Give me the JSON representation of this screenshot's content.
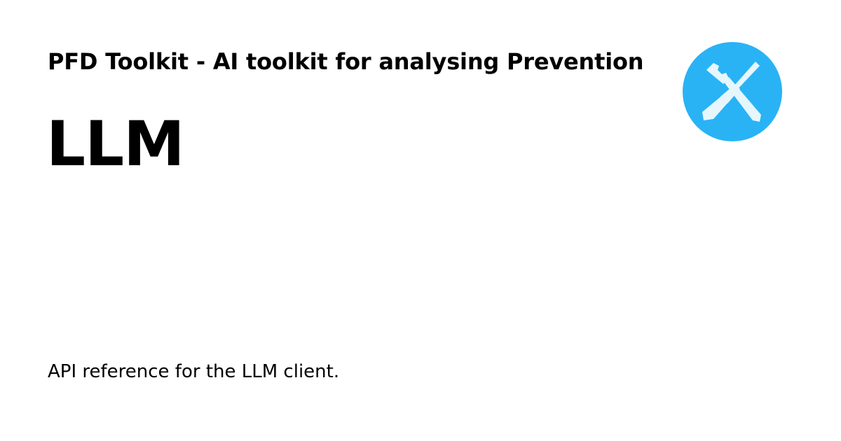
{
  "site": {
    "title": "PFD Toolkit - AI toolkit for analysing Prevention"
  },
  "page": {
    "title": "LLM",
    "description": "API reference for the LLM client."
  },
  "logo": {
    "icon": "tools-icon",
    "background_color": "#29b3f4",
    "foreground_color": "#e6f6fd"
  }
}
